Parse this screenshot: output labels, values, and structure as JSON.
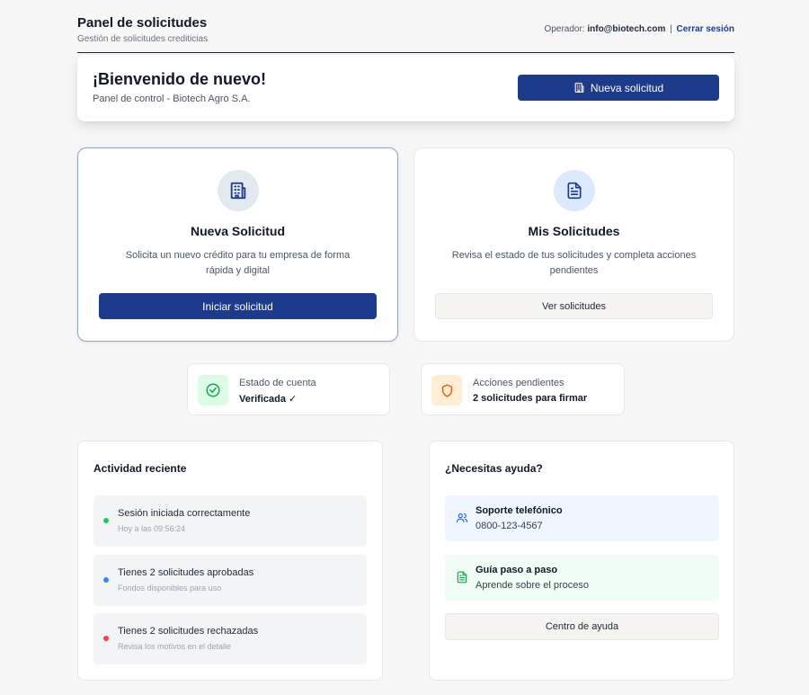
{
  "header": {
    "title": "Panel de solicitudes",
    "subtitle": "Gestión de solicitudes crediticias",
    "operator_label": "Operador:",
    "operator_email": "info@biotech.com",
    "separator": "|",
    "logout_label": "Cerrar sesión"
  },
  "welcome": {
    "title": "¡Bienvenido de nuevo!",
    "subtitle": "Panel de control - Biotech Agro S.A.",
    "button_label": "Nueva solicitud",
    "button_icon": "building-icon"
  },
  "actions": [
    {
      "title": "Nueva Solicitud",
      "description": "Solicita un nuevo crédito para tu empresa de forma rápida y digital",
      "button_label": "Iniciar solicitud",
      "icon": "building-icon"
    },
    {
      "title": "Mis Solicitudes",
      "description": "Revisa el estado de tus solicitudes y completa acciones pendientes",
      "button_label": "Ver solicitudes",
      "icon": "document-icon"
    }
  ],
  "status": [
    {
      "label": "Estado de cuenta",
      "value": "Verificada ✓",
      "icon": "check-circle-icon",
      "color": "#16a34a",
      "bg": "#dcfce7"
    },
    {
      "label": "Acciones pendientes",
      "value": "2 solicitudes para firmar",
      "icon": "shield-icon",
      "color": "#ea580c",
      "bg": "#ffedd5"
    }
  ],
  "activity": {
    "title": "Actividad reciente",
    "items": [
      {
        "text": "Sesión iniciada correctamente",
        "detail": "Hoy a las 09:56:24",
        "color": "#22c55e"
      },
      {
        "text": "Tienes 2 solicitudes aprobadas",
        "detail": "Fondos disponibles para uso",
        "color": "#3b82f6"
      },
      {
        "text": "Tienes 2 solicitudes rechazadas",
        "detail": "Revisa los motivos en el detalle",
        "color": "#ef4444"
      }
    ]
  },
  "help": {
    "title": "¿Necesitas ayuda?",
    "items": [
      {
        "title": "Soporte telefónico",
        "detail": "0800-123-4567",
        "icon": "users-icon",
        "bg": "#eff6ff",
        "color": "#2563eb"
      },
      {
        "title": "Guía paso a paso",
        "detail": "Aprende sobre el proceso",
        "icon": "document-icon",
        "bg": "#f0fdf4",
        "color": "#16a34a"
      }
    ],
    "button_label": "Centro de ayuda"
  },
  "colors": {
    "primary": "#1e3a8a",
    "background": "#f7f7f7"
  }
}
